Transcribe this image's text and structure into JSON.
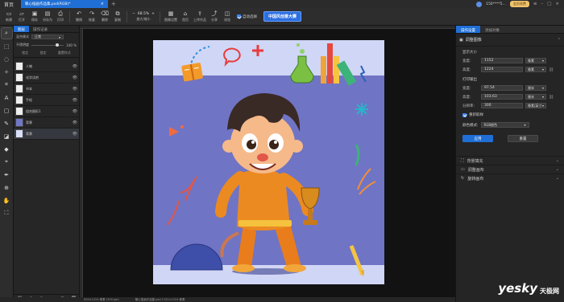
{
  "titlebar": {
    "home_label": "首页",
    "doc_tab": "暖心插画作品集.psd(RGB)*",
    "user_id": "150****5...",
    "vip_label": "会员续费"
  },
  "toolbar": {
    "buttons": [
      {
        "label": "新建",
        "icon": "new-file-icon"
      },
      {
        "label": "打开",
        "icon": "open-folder-icon"
      },
      {
        "label": "保存",
        "icon": "save-icon"
      },
      {
        "label": "另存为",
        "icon": "save-as-icon"
      },
      {
        "label": "打印",
        "icon": "print-icon"
      },
      {
        "label": "撤销",
        "icon": "undo-icon"
      },
      {
        "label": "恢复",
        "icon": "redo-icon"
      },
      {
        "label": "删除",
        "icon": "delete-icon"
      },
      {
        "label": "复制",
        "icon": "copy-icon"
      }
    ],
    "zoom_value": "68.5%",
    "zoom_label": "放大/缩小",
    "buttons2": [
      {
        "label": "图像设置",
        "icon": "image-settings-icon"
      },
      {
        "label": "首页",
        "icon": "home-icon"
      },
      {
        "label": "上传作品",
        "icon": "upload-icon"
      },
      {
        "label": "分享",
        "icon": "share-icon"
      },
      {
        "label": "浏览",
        "icon": "browse-icon"
      }
    ],
    "auto_select_label": "自动选择",
    "contest_label": "中国风创意大赛"
  },
  "layers_panel": {
    "tab_layers": "图层",
    "tab_history": "操作记录",
    "blend_label": "混合模式",
    "blend_value": "正常",
    "opacity_label": "不透明度",
    "opacity_value": "100 %",
    "lock_label_1": "锁定",
    "lock_label_2": "锁定",
    "lock_label_3": "重置样式",
    "layers": [
      {
        "name": "人物"
      },
      {
        "name": "化学试剂"
      },
      {
        "name": "书本"
      },
      {
        "name": "手绘"
      },
      {
        "name": "组合图形1"
      },
      {
        "name": "背景"
      },
      {
        "name": "背景"
      }
    ]
  },
  "right_panel": {
    "tab_adjust": "操作设置",
    "tab_add": "添加对象",
    "section_title": "调整图像",
    "display_size_label": "显示大小",
    "width_label": "宽度:",
    "height_label": "高度:",
    "display_width": "1152",
    "display_height": "1224",
    "pixel_unit": "像素",
    "print_output_label": "打印输出",
    "print_width": "97.54",
    "print_height": "103.63",
    "print_unit": "厘米",
    "resolution_label": "分辨率:",
    "resolution_value": "300",
    "resolution_unit": "像素/英寸",
    "resample_label": "重新取样",
    "color_mode_label": "颜色模式:",
    "color_mode_value": "RGB颜色",
    "apply_label": "应用",
    "reset_label": "重置",
    "sections": [
      {
        "label": "背景填充",
        "icon": "fill-icon"
      },
      {
        "label": "调整画布",
        "icon": "canvas-icon"
      },
      {
        "label": "旋转画布",
        "icon": "rotate-icon"
      }
    ]
  },
  "statusbar": {
    "left_text": "500×1224 像素 (300 ppi)",
    "mid_text": "暖心插画作品集.psd 1152×1224 像素"
  },
  "watermark": {
    "main": "yesky",
    "sub": "天极网"
  }
}
